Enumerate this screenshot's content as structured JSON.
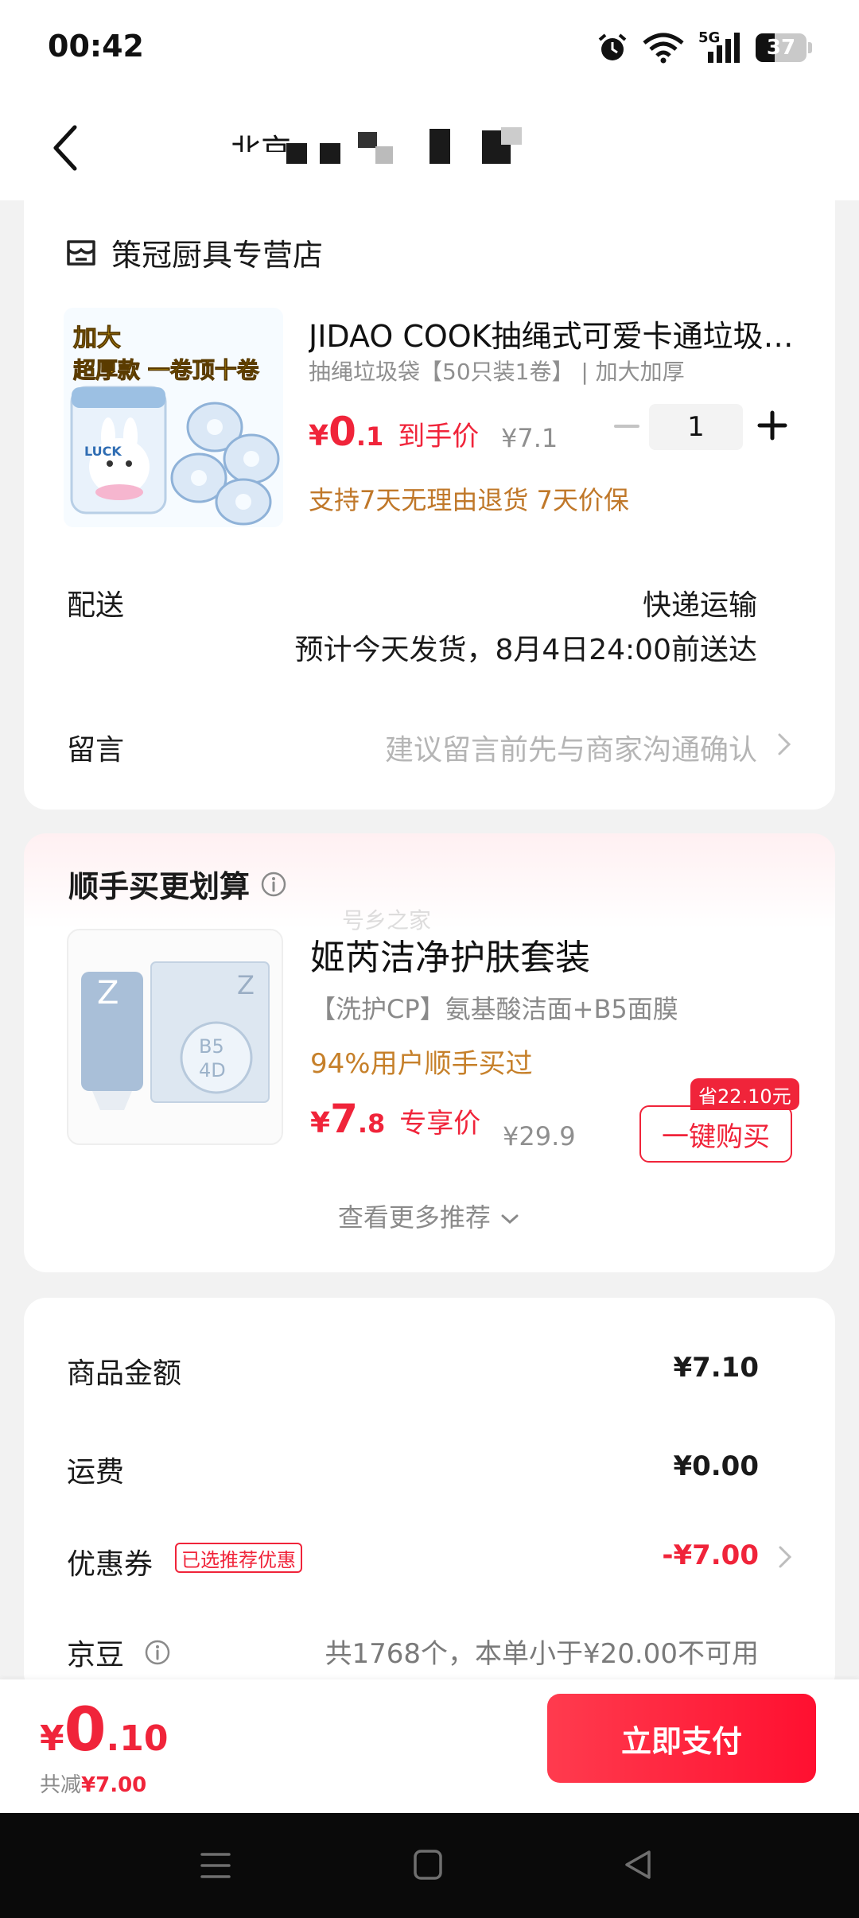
{
  "status_bar": {
    "time": "00:42",
    "network": "5G",
    "battery": "37"
  },
  "header": {
    "address_redacted": "北京"
  },
  "order": {
    "store_name": "策冠厨具专营店",
    "product": {
      "title": "JIDAO COOK抽绳式可爱卡通垃圾…",
      "spec": "抽绳垃圾袋【50只装1卷】 | 加大加厚",
      "price_currency": "¥",
      "price_int": "0",
      "price_dec": ".1",
      "price_tag": "到手价",
      "original_price": "¥7.1",
      "quantity": "1",
      "service_tip": "支持7天无理由退货  7天价保",
      "image_text_1": "加大",
      "image_text_2": "超厚款 一卷顶十卷",
      "image_text_3": "LUCK"
    },
    "delivery": {
      "label": "配送",
      "method": "快递运输",
      "eta": "预计今天发货，8月4日24:00前送达"
    },
    "message": {
      "label": "留言",
      "placeholder": "建议留言前先与商家沟通确认"
    }
  },
  "recommend": {
    "title": "顺手买更划算",
    "watermark": "号乡之家",
    "item": {
      "name": "姬芮洁净护肤套装",
      "desc": "【洗护CP】氨基酸洁面+B5面膜",
      "bought_pct": "94%用户顺手买过",
      "price_currency": "¥",
      "price_int": "7",
      "price_dec": ".8",
      "price_tag": "专享价",
      "original_price": "¥29.9",
      "save_badge": "省22.10元",
      "buy_label": "一键购买"
    },
    "see_more": "查看更多推荐"
  },
  "summary": {
    "goods_label": "商品金额",
    "goods_value": "¥7.10",
    "shipping_label": "运费",
    "shipping_value": "¥0.00",
    "coupon_label": "优惠券",
    "coupon_tag": "已选推荐优惠",
    "coupon_value": "-¥7.00",
    "jd_label": "京豆",
    "jd_desc": "共1768个，本单小于¥20.00不可用"
  },
  "pay_bar": {
    "total_currency": "¥",
    "total_int": "0",
    "total_dec": ".10",
    "save_prefix": "共减",
    "save_value": "¥7.00",
    "pay_label": "立即支付"
  },
  "colors": {
    "accent": "#f0243a",
    "promo": "#c0782a",
    "background": "#f2f2f2"
  }
}
